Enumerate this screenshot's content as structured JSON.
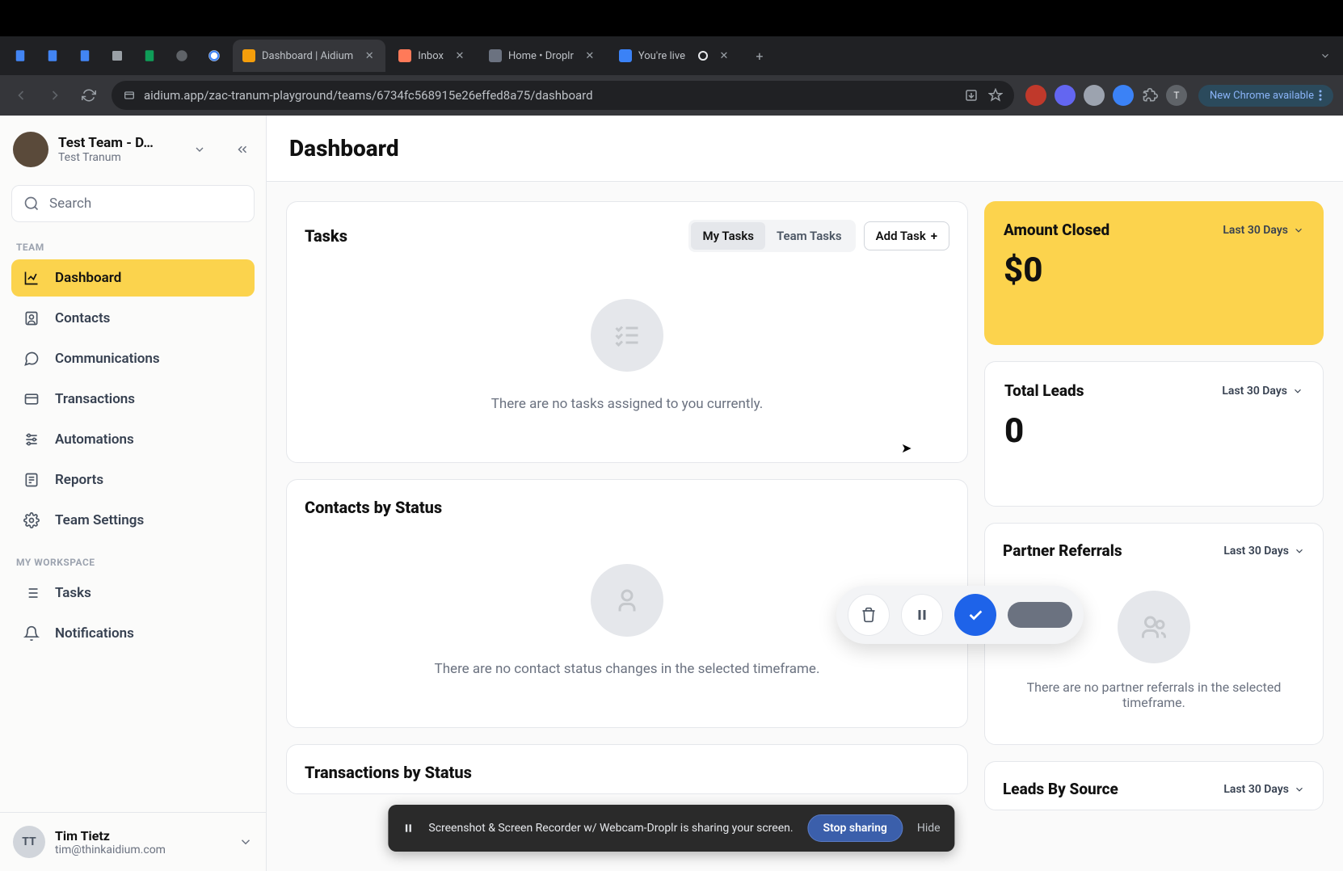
{
  "browser": {
    "tabs": [
      {
        "title": "Dashboard | Aidium",
        "active": true,
        "favicon": "#f59e0b"
      },
      {
        "title": "Inbox",
        "active": false,
        "favicon": "#ff7a59"
      },
      {
        "title": "Home • Droplr",
        "active": false,
        "favicon": "#6b7280"
      },
      {
        "title": "You're live",
        "active": false,
        "favicon": "#3b82f6"
      }
    ],
    "url": "aidium.app/zac-tranum-playground/teams/6734fc568915e26effed8a75/dashboard",
    "update_btn": "New Chrome available"
  },
  "sidebar": {
    "team_name": "Test Team - D…",
    "team_user": "Test Tranum",
    "search_placeholder": "Search",
    "sections": {
      "team": {
        "label": "TEAM",
        "items": [
          {
            "label": "Dashboard",
            "active": true
          },
          {
            "label": "Contacts"
          },
          {
            "label": "Communications"
          },
          {
            "label": "Transactions"
          },
          {
            "label": "Automations"
          },
          {
            "label": "Reports"
          },
          {
            "label": "Team Settings"
          }
        ]
      },
      "workspace": {
        "label": "MY WORKSPACE",
        "items": [
          {
            "label": "Tasks"
          },
          {
            "label": "Notifications"
          }
        ]
      }
    },
    "footer": {
      "initials": "TT",
      "name": "Tim Tietz",
      "email": "tim@thinkaidium.com"
    }
  },
  "main": {
    "title": "Dashboard",
    "tasks": {
      "title": "Tasks",
      "my_tasks": "My Tasks",
      "team_tasks": "Team Tasks",
      "add_task": "Add Task",
      "empty": "There are no tasks assigned to you currently."
    },
    "amount_closed": {
      "title": "Amount Closed",
      "period": "Last 30 Days",
      "value": "$0"
    },
    "total_leads": {
      "title": "Total Leads",
      "period": "Last 30 Days",
      "value": "0"
    },
    "contacts_by_status": {
      "title": "Contacts by Status",
      "empty": "There are no contact status changes in the selected timeframe."
    },
    "partner_referrals": {
      "title": "Partner Referrals",
      "period": "Last 30 Days",
      "empty": "There are no partner referrals in the selected timeframe."
    },
    "transactions_by_status": {
      "title": "Transactions by Status"
    },
    "leads_by_source": {
      "title": "Leads By Source",
      "period": "Last 30 Days"
    }
  },
  "share_bar": {
    "text": "Screenshot & Screen Recorder w/ Webcam-Droplr is sharing your screen.",
    "stop": "Stop sharing",
    "hide": "Hide"
  }
}
